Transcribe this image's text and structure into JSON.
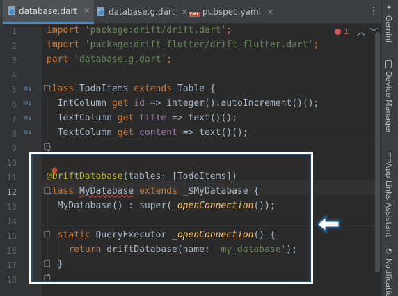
{
  "tabs": [
    {
      "label": "database.dart",
      "icon": "dart-file-icon",
      "active": true
    },
    {
      "label": "database.g.dart",
      "icon": "dart-file-icon",
      "active": false
    },
    {
      "label": "pubspec.yaml",
      "icon": "yaml-file-icon",
      "active": false
    }
  ],
  "tab_close": "✕",
  "yaml_badge": "YML",
  "inspection": {
    "error_count": "1",
    "prev_icon": "chevron-up-icon",
    "next_icon": "chevron-down-icon"
  },
  "right_tools": [
    {
      "label": "Gemini",
      "icon": "gemini-icon"
    },
    {
      "label": "Device Manager",
      "icon": "device-manager-icon"
    },
    {
      "label": "App Links Assistant",
      "icon": "app-links-icon"
    },
    {
      "label": "Notifications",
      "icon": "bell-icon"
    }
  ],
  "line_numbers": [
    "1",
    "2",
    "3",
    "4",
    "5",
    "6",
    "7",
    "8",
    "9",
    "10",
    "11",
    "12",
    "13",
    "14",
    "15",
    "16",
    "17",
    "18"
  ],
  "current_line": "12",
  "code": {
    "l1": {
      "kw": "import",
      "str": "'package:drift/drift.dart'",
      "end": ";"
    },
    "l2": {
      "kw": "import",
      "str": "'package:drift_flutter/drift_flutter.dart'",
      "end": ";"
    },
    "l3": {
      "kw": "part",
      "str": "'database.g.dart'",
      "end": ";"
    },
    "l5": {
      "kw1": "class",
      "name": "TodoItems",
      "kw2": "extends",
      "rest": "Table {"
    },
    "l6": {
      "type": "IntColumn",
      "kw": "get",
      "fld": "id",
      "rest": "=> integer().autoIncrement()();"
    },
    "l7": {
      "type": "TextColumn",
      "kw": "get",
      "fld": "title",
      "rest": "=> text()();"
    },
    "l8": {
      "type": "TextColumn",
      "kw": "get",
      "fld": "content",
      "rest": "=> text()();"
    },
    "l9": "}",
    "l11": {
      "ann": "@DriftDatabase",
      "rest": "(tables: [TodoItems])"
    },
    "l12": {
      "kw1": "class",
      "name": "MyDatabase",
      "kw2": "extends",
      "rest": "_$MyDatabase {"
    },
    "l13": {
      "ctor": "MyDatabase",
      "mid": "() : super(",
      "fn": "_openConnection",
      "end": "());"
    },
    "l15": {
      "kw": "static",
      "type": "QueryExecutor",
      "fn": "_openConnection",
      "end": "() {"
    },
    "l16": {
      "kw": "return",
      "call": "driftDatabase(name: ",
      "str": "'my_database'",
      "end": ");"
    },
    "l17": "}",
    "l18": "}"
  }
}
